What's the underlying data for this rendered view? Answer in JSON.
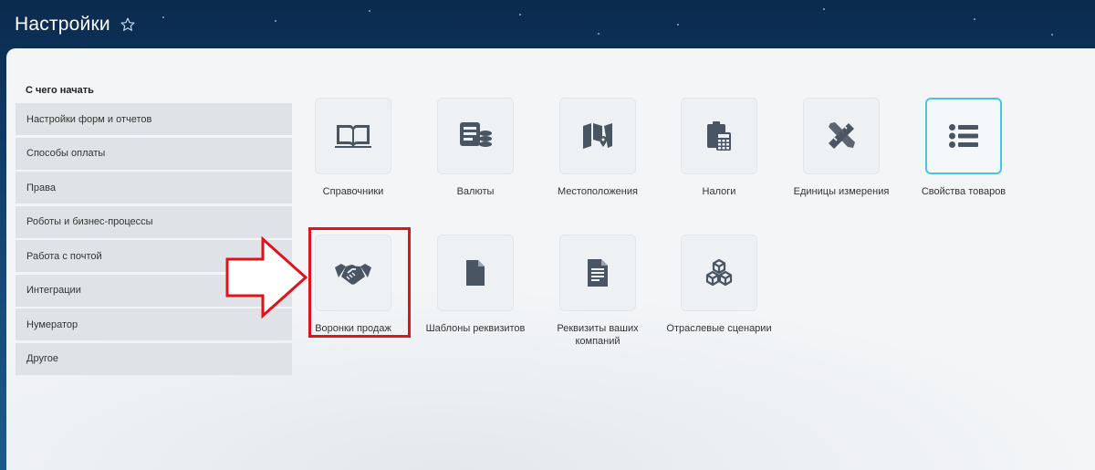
{
  "header": {
    "title": "Настройки"
  },
  "sidebar": {
    "heading": "С чего начать",
    "items": [
      {
        "label": "Настройки форм и отчетов"
      },
      {
        "label": "Способы оплаты"
      },
      {
        "label": "Права"
      },
      {
        "label": "Роботы и бизнес-процессы"
      },
      {
        "label": "Работа с почтой"
      },
      {
        "label": "Интеграции"
      },
      {
        "label": "Нумератор"
      },
      {
        "label": "Другое"
      }
    ]
  },
  "tiles": [
    {
      "label": "Справочники",
      "icon": "book-icon"
    },
    {
      "label": "Валюты",
      "icon": "currency-icon"
    },
    {
      "label": "Местоположения",
      "icon": "map-icon"
    },
    {
      "label": "Налоги",
      "icon": "calculator-icon"
    },
    {
      "label": "Единицы измерения",
      "icon": "ruler-pencil-icon"
    },
    {
      "label": "Свойства товаров",
      "icon": "list-icon"
    },
    {
      "label": "Воронки продаж",
      "icon": "handshake-icon"
    },
    {
      "label": "Шаблоны реквизитов",
      "icon": "document-icon"
    },
    {
      "label": "Реквизиты ваших компаний",
      "icon": "text-document-icon"
    },
    {
      "label": "Отраслевые сценарии",
      "icon": "cubes-icon"
    }
  ],
  "colors": {
    "accent": "#46c6e6",
    "highlight": "#e0121c",
    "icon": "#4a5563"
  }
}
